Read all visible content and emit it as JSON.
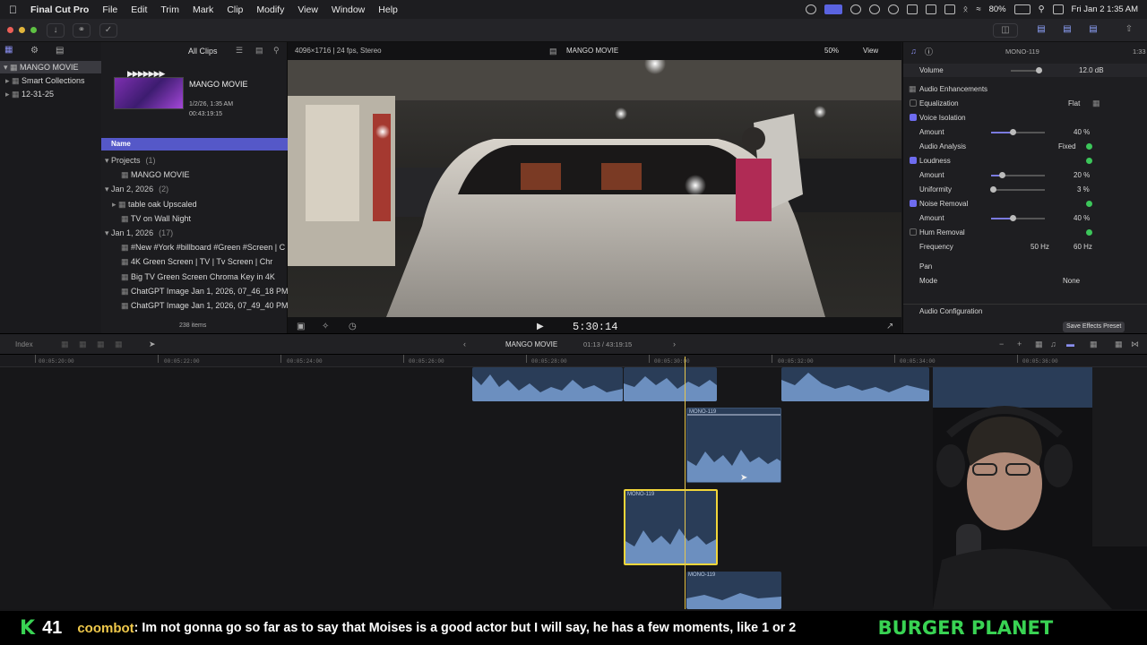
{
  "menubar": {
    "app": "Final Cut Pro",
    "items": [
      "File",
      "Edit",
      "Trim",
      "Mark",
      "Clip",
      "Modify",
      "View",
      "Window",
      "Help"
    ],
    "battery": "80%",
    "datetime": "Fri Jan 2  1:35 AM"
  },
  "library": {
    "library_name": "MANGO MOVIE",
    "smart_collections": "Smart Collections",
    "event": "12-31-25"
  },
  "browser": {
    "filter": "All Clips",
    "project_title": "MANGO MOVIE",
    "project_date": "1/2/26, 1:35 AM",
    "project_duration": "00:43:19:15",
    "column_name": "Name",
    "sections": [
      {
        "label": "Projects",
        "count": "(1)",
        "items": [
          "MANGO MOVIE"
        ]
      },
      {
        "label": "Jan 2, 2026",
        "count": "(2)",
        "items": [
          "table oak Upscaled",
          "TV on Wall Night"
        ]
      },
      {
        "label": "Jan 1, 2026",
        "count": "(17)",
        "items": [
          "#New #York #billboard #Green #Screen | C",
          "4K Green Screen  |  TV  |  Tv Screen  |  Chr",
          "Big TV Green Screen Chroma Key in 4K",
          "ChatGPT Image Jan 1, 2026, 07_46_18 PM",
          "ChatGPT Image Jan 1, 2026, 07_49_40 PM"
        ]
      }
    ],
    "item_count": "238 items"
  },
  "viewer": {
    "format": "4096×1716 | 24 fps, Stereo",
    "title": "MANGO MOVIE",
    "zoom": "50%",
    "view": "View",
    "timecode": "5:30:14"
  },
  "inspector": {
    "clip_name": "MONO-119",
    "duration": "1:33",
    "volume": {
      "label": "Volume",
      "value": "12.0 dB"
    },
    "section": "Audio Enhancements",
    "eq": {
      "label": "Equalization",
      "value": "Flat"
    },
    "voice_isolation": {
      "label": "Voice Isolation",
      "amount_label": "Amount",
      "amount": "40 %",
      "amount_frac": 0.4
    },
    "audio_analysis": {
      "label": "Audio Analysis",
      "value": "Fixed"
    },
    "loudness": {
      "label": "Loudness",
      "amount_label": "Amount",
      "amount": "20 %",
      "amount_frac": 0.2,
      "uniformity_label": "Uniformity",
      "uniformity": "3 %",
      "uniformity_frac": 0.03
    },
    "noise_removal": {
      "label": "Noise Removal",
      "amount_label": "Amount",
      "amount": "40 %",
      "amount_frac": 0.4
    },
    "hum_removal": {
      "label": "Hum Removal",
      "freq_label": "Frequency",
      "freq_50": "50 Hz",
      "freq_60": "60 Hz"
    },
    "pan": {
      "label": "Pan",
      "mode_label": "Mode",
      "mode": "None"
    },
    "config": "Audio Configuration",
    "save_preset": "Save Effects Preset"
  },
  "timeline": {
    "index": "Index",
    "project": "MANGO MOVIE",
    "position": "01:13 / 43:19:15",
    "ruler": [
      "00:05:20:00",
      "00:05:22:00",
      "00:05:24:00",
      "00:05:26:00",
      "00:05:28:00",
      "00:05:30:00",
      "00:05:32:00",
      "00:05:34:00",
      "00:05:36:00"
    ],
    "clip_label": "MONO-119"
  },
  "chat": {
    "count": "41",
    "user": "coombot",
    "message": ": Im not gonna go so far as to say that Moises is a good actor but I will say, he has a few moments, like 1 or 2",
    "brand": "BURGER PLANET"
  },
  "colors": {
    "accent": "#6e6cf0",
    "playhead": "#e6c64d",
    "selected_clip": "#f2d63a",
    "audio_clip": "#2a3d58",
    "chat_green": "#39d353"
  }
}
